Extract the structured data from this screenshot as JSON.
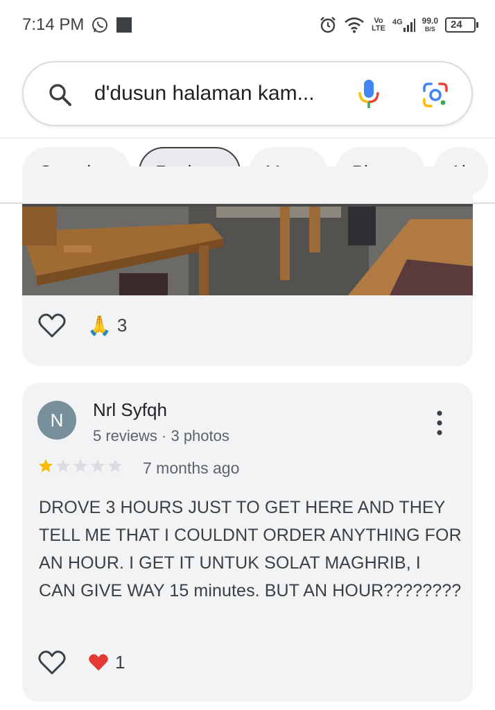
{
  "status_bar": {
    "time": "7:14 PM",
    "volte_top": "Vo",
    "volte_bottom": "LTE",
    "network": "4G",
    "speed_value": "99.0",
    "speed_unit": "B/S",
    "battery": "24"
  },
  "search": {
    "query": "d'dusun halaman kam..."
  },
  "tabs": [
    {
      "label": "Overview",
      "active": false
    },
    {
      "label": "Reviews",
      "active": true
    },
    {
      "label": "Menu",
      "active": false
    },
    {
      "label": "Photos",
      "active": false
    },
    {
      "label": "Ab",
      "active": false
    }
  ],
  "prev_review": {
    "reaction_emoji": "🙏",
    "reaction_count": "3"
  },
  "review": {
    "avatar_initial": "N",
    "reviewer_name": "Nrl Syfqh",
    "reviewer_meta": "5 reviews · 3 photos",
    "rating": 1,
    "rating_max": 5,
    "date": "7 months ago",
    "text": "DROVE 3 HOURS JUST TO GET HERE AND THEY TELL ME THAT I COULDNT ORDER ANYTHING FOR AN HOUR. I GET IT UNTUK SOLAT MAGHRIB, I CAN GIVE WAY 15 minutes. BUT AN HOUR????????",
    "reaction_emoji": "❤️",
    "reaction_count": "1"
  },
  "colors": {
    "star_filled": "#fbbc04",
    "star_empty": "#dadce0",
    "avatar_bg": "#78909c",
    "heart_reaction": "#e53935"
  }
}
